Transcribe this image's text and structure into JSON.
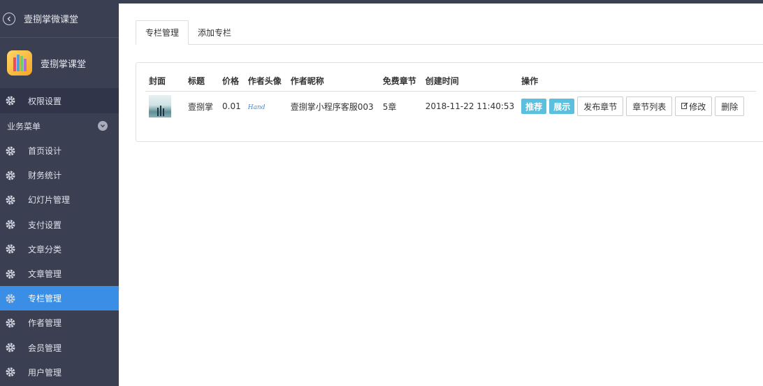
{
  "sidebar": {
    "app_title": "壹捌掌微课堂",
    "brand_name": "壹捌掌课堂",
    "permission_label": "权限设置",
    "group_label": "业务菜单",
    "items": [
      {
        "label": "首页设计"
      },
      {
        "label": "财务统计"
      },
      {
        "label": "幻灯片管理"
      },
      {
        "label": "支付设置"
      },
      {
        "label": "文章分类"
      },
      {
        "label": "文章管理"
      },
      {
        "label": "专栏管理",
        "active": true
      },
      {
        "label": "作者管理"
      },
      {
        "label": "会员管理"
      },
      {
        "label": "用户管理"
      }
    ]
  },
  "tabs": [
    {
      "label": "专栏管理",
      "active": true
    },
    {
      "label": "添加专栏"
    }
  ],
  "table": {
    "headers": [
      "封面",
      "标题",
      "价格",
      "作者头像",
      "作者昵称",
      "免费章节",
      "创建时间",
      "操作"
    ],
    "rows": [
      {
        "title": "壹捌掌",
        "price": "0.01",
        "avatar_text": "Hand",
        "author": "壹捌掌小程序客服003",
        "free_chapters": "5章",
        "created": "2018-11-22 11:40:53"
      }
    ],
    "actions": {
      "recommend": "推荐",
      "show": "展示",
      "publish_chapter": "发布章节",
      "chapter_list": "章节列表",
      "edit": "修改",
      "delete": "删除"
    }
  },
  "colors": {
    "sidebar_bg": "#3a3f51",
    "active_item": "#3a8ee6",
    "info_button": "#5bc0de"
  },
  "icons": {
    "back": "circle-chevron-left-icon",
    "menu": "gear-icon",
    "group_toggle": "chevron-down-icon",
    "edit": "pencil-square-icon"
  }
}
